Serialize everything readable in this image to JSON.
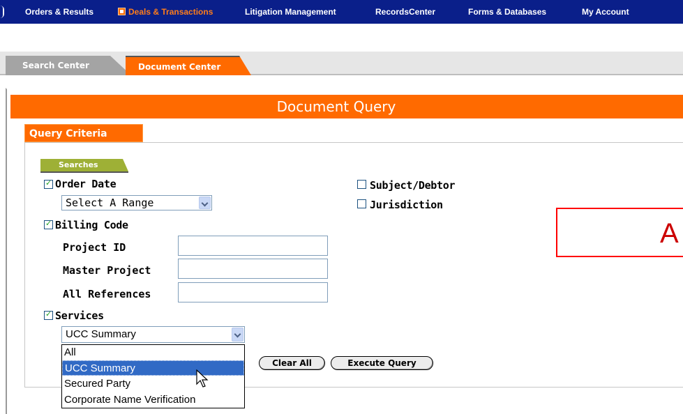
{
  "nav": {
    "items": [
      {
        "label": "Orders & Results",
        "active": false
      },
      {
        "label": "Deals & Transactions",
        "active": true
      },
      {
        "label": "Litigation Management",
        "active": false
      },
      {
        "label": "RecordsCenter",
        "active": false
      },
      {
        "label": "Forms & Databases",
        "active": false
      },
      {
        "label": "My Account",
        "active": false
      }
    ]
  },
  "tabs": {
    "search_center": "Search Center",
    "document_center": "Document Center"
  },
  "page": {
    "title": "Document Query",
    "section_tab": "Query Criteria",
    "searches_tab": "Searches"
  },
  "criteria": {
    "order_date": {
      "label": "Order Date",
      "checked": true,
      "range_value": "Select A Range"
    },
    "subject_debtor": {
      "label": "Subject/Debtor",
      "checked": false
    },
    "jurisdiction": {
      "label": "Jurisdiction",
      "checked": false
    },
    "billing_code": {
      "label": "Billing Code",
      "checked": true
    },
    "project_id": {
      "label": "Project ID",
      "value": ""
    },
    "master_project": {
      "label": "Master Project",
      "value": ""
    },
    "all_references": {
      "label": "All References",
      "value": ""
    },
    "services": {
      "label": "Services",
      "checked": true,
      "selected": "UCC Summary",
      "options": [
        "All",
        "UCC Summary",
        "Secured Party",
        "Corporate Name Verification"
      ]
    }
  },
  "buttons": {
    "clear_all": "Clear All",
    "execute_query": "Execute Query"
  },
  "annotation": {
    "label": "A",
    "color": "#ff0000"
  },
  "colors": {
    "nav_bg": "#0a1f8a",
    "accent": "#ff6a00",
    "searches_tab": "#9eb036",
    "selection": "#316ac5"
  }
}
